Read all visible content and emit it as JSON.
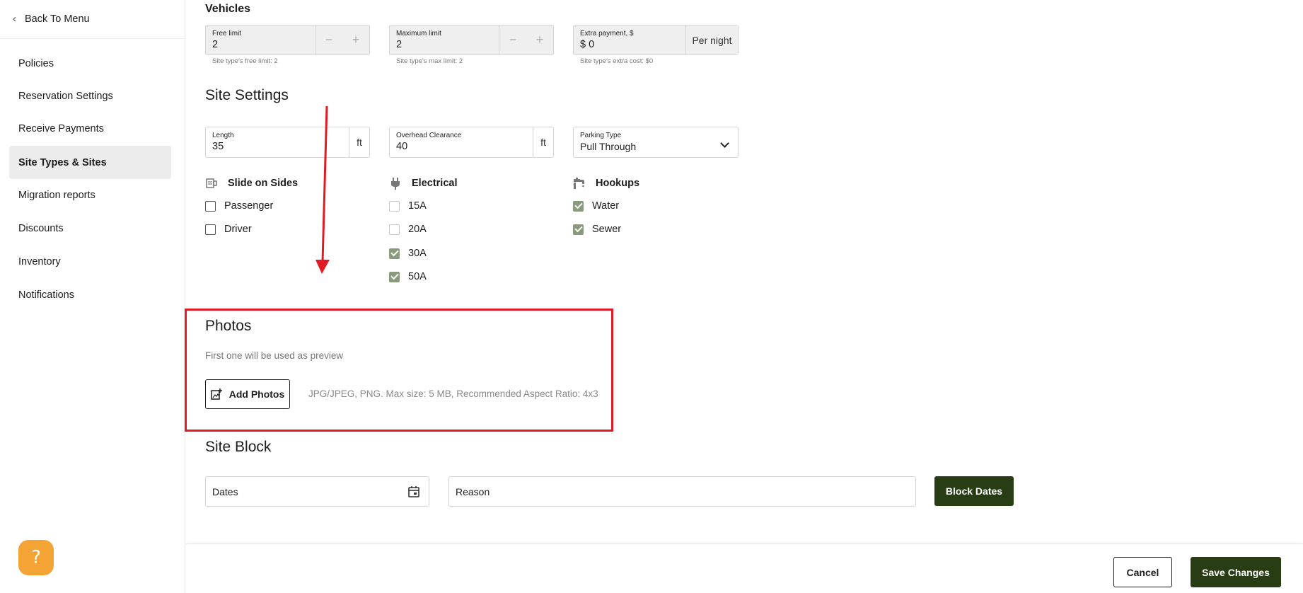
{
  "sidebar": {
    "back_label": "Back To Menu",
    "items": [
      {
        "label": "Policies"
      },
      {
        "label": "Reservation Settings"
      },
      {
        "label": "Receive Payments"
      },
      {
        "label": "Site Types & Sites",
        "active": true
      },
      {
        "label": "Migration reports"
      },
      {
        "label": "Discounts"
      },
      {
        "label": "Inventory"
      },
      {
        "label": "Notifications"
      }
    ]
  },
  "help_label": "?",
  "vehicles": {
    "title": "Vehicles",
    "free_limit": {
      "label": "Free limit",
      "value": "2",
      "hint": "Site type's free limit: 2"
    },
    "max_limit": {
      "label": "Maximum limit",
      "value": "2",
      "hint": "Site type's max limit: 2"
    },
    "extra_payment": {
      "label": "Extra payment, $",
      "value": "$ 0",
      "suffix": "Per night",
      "hint": "Site type's extra cost: $0"
    },
    "minus": "−",
    "plus": "+"
  },
  "site_settings": {
    "title": "Site Settings",
    "length": {
      "label": "Length",
      "value": "35",
      "unit": "ft"
    },
    "overhead": {
      "label": "Overhead Clearance",
      "value": "40",
      "unit": "ft"
    },
    "parking": {
      "label": "Parking Type",
      "value": "Pull Through"
    },
    "slide_title": "Slide on Sides",
    "slide_options": [
      {
        "label": "Passenger",
        "checked": false
      },
      {
        "label": "Driver",
        "checked": false
      }
    ],
    "electrical_title": "Electrical",
    "electrical_options": [
      {
        "label": "15A",
        "checked": false
      },
      {
        "label": "20A",
        "checked": false
      },
      {
        "label": "30A",
        "checked": true
      },
      {
        "label": "50A",
        "checked": true
      }
    ],
    "hookups_title": "Hookups",
    "hookup_options": [
      {
        "label": "Water",
        "checked": true
      },
      {
        "label": "Sewer",
        "checked": true
      }
    ]
  },
  "photos": {
    "title": "Photos",
    "subtitle": "First one will be used as preview",
    "add_label": "Add Photos",
    "requirements": "JPG/JPEG, PNG. Max size: 5 MB, Recommended Aspect Ratio: 4x3"
  },
  "site_block": {
    "title": "Site Block",
    "dates_placeholder": "Dates",
    "reason_placeholder": "Reason",
    "block_label": "Block Dates"
  },
  "footer": {
    "cancel_label": "Cancel",
    "save_label": "Save Changes"
  },
  "colors": {
    "accent_dark_green": "#283d14",
    "checkbox_checked": "#8a9a7c",
    "help_orange": "#f4a435",
    "annotation_red": "#e01b24"
  }
}
